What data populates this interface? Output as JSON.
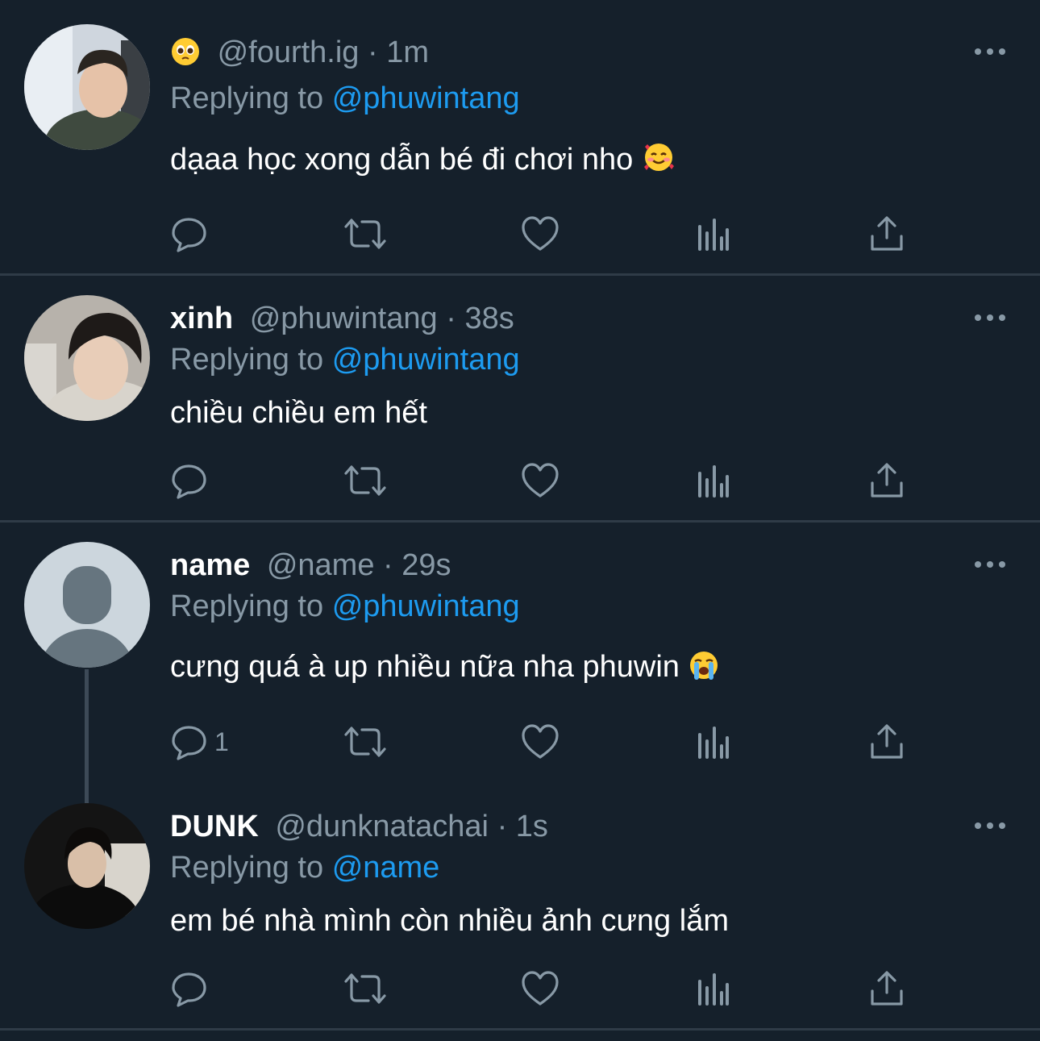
{
  "colors": {
    "background": "#15202b",
    "divider": "#2f3b47",
    "muted": "#8899a6",
    "link": "#1d9bf0",
    "text": "#ffffff"
  },
  "tweets": [
    {
      "display_name": "",
      "name_icon": "pleading-face-emoji",
      "handle": "@fourth.ig",
      "dot": "·",
      "time": "1m",
      "replying_prefix": "Replying to",
      "replying_to": "@phuwintang",
      "text": "dạaa học xong dẫn bé đi chơi nho",
      "text_icon": "smiling-face-with-hearts-emoji",
      "reply_count": ""
    },
    {
      "display_name": "xinh",
      "handle": "@phuwintang",
      "dot": "·",
      "time": "38s",
      "replying_prefix": "Replying to",
      "replying_to": "@phuwintang",
      "text": "chiều chiều em hết",
      "reply_count": ""
    },
    {
      "display_name": "name",
      "handle": "@name",
      "dot": "·",
      "time": "29s",
      "replying_prefix": "Replying to",
      "replying_to": "@phuwintang",
      "text": "cưng quá à up nhiều nữa nha phuwin",
      "text_icon": "loudly-crying-face-emoji",
      "reply_count": "1"
    },
    {
      "display_name": "DUNK",
      "handle": "@dunknatachai",
      "dot": "·",
      "time": "1s",
      "replying_prefix": "Replying to",
      "replying_to": "@name",
      "text": "em bé nhà mình còn nhiều ảnh cưng lắm",
      "reply_count": ""
    }
  ],
  "action_icons": [
    "reply-icon",
    "retweet-icon",
    "like-icon",
    "analytics-icon",
    "share-icon"
  ]
}
